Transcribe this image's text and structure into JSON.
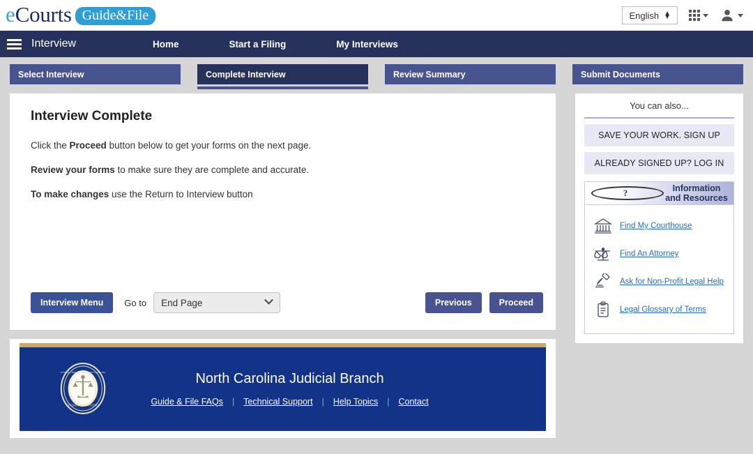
{
  "brand": {
    "e": "e",
    "courts": "Courts",
    "pill": "Guide&File"
  },
  "topbar": {
    "language": "English",
    "grid_icon": "apps-grid-icon",
    "avatar_icon": "user-avatar-icon"
  },
  "nav": {
    "menu_icon": "hamburger-menu-icon",
    "title": "Interview",
    "links": [
      {
        "label": "Home"
      },
      {
        "label": "Start a Filing"
      },
      {
        "label": "My Interviews"
      }
    ]
  },
  "steps": [
    {
      "label": "Select Interview",
      "active": false
    },
    {
      "label": "Complete Interview",
      "active": true
    },
    {
      "label": "Review Summary",
      "active": false
    },
    {
      "label": "Submit Documents",
      "active": false
    }
  ],
  "main": {
    "heading": "Interview Complete",
    "p1_pre": "Click the ",
    "p1_bold": "Proceed",
    "p1_post": " button below to get your forms on the next page.",
    "p2_bold": "Review your forms",
    "p2_post": " to make sure they are complete and accurate.",
    "p3_bold": "To make changes",
    "p3_post": " use the Return to Interview button",
    "interview_menu": "Interview Menu",
    "goto_label": "Go to",
    "goto_value": "End Page",
    "previous": "Previous",
    "proceed": "Proceed"
  },
  "sidebar": {
    "title": "You can also...",
    "buttons": [
      {
        "label": "SAVE YOUR WORK. SIGN UP"
      },
      {
        "label": "ALREADY SIGNED UP? LOG IN"
      }
    ],
    "info_heading": "Information and Resources",
    "help_icon": "question-mark-icon",
    "resources": [
      {
        "label": "Find My Courthouse",
        "icon": "courthouse-icon"
      },
      {
        "label": "Find An Attorney",
        "icon": "scales-of-justice-icon"
      },
      {
        "label": "Ask for Non-Profit Legal Help",
        "icon": "gavel-icon"
      },
      {
        "label": "Legal Glossary of Terms",
        "icon": "clipboard-icon"
      }
    ]
  },
  "footer": {
    "seal_icon": "north-carolina-judicial-seal",
    "title": "North Carolina Judicial Branch",
    "links": [
      {
        "label": "Guide & File FAQs"
      },
      {
        "label": "Technical Support"
      },
      {
        "label": "Help Topics"
      },
      {
        "label": "Contact"
      }
    ],
    "separator": "|"
  },
  "colors": {
    "navy": "#27325c",
    "step_blue": "#48548f",
    "footer_blue": "#123387",
    "gold": "#c9a86a",
    "link_blue": "#2a6ebb",
    "page_bg": "#d6d6d6"
  }
}
